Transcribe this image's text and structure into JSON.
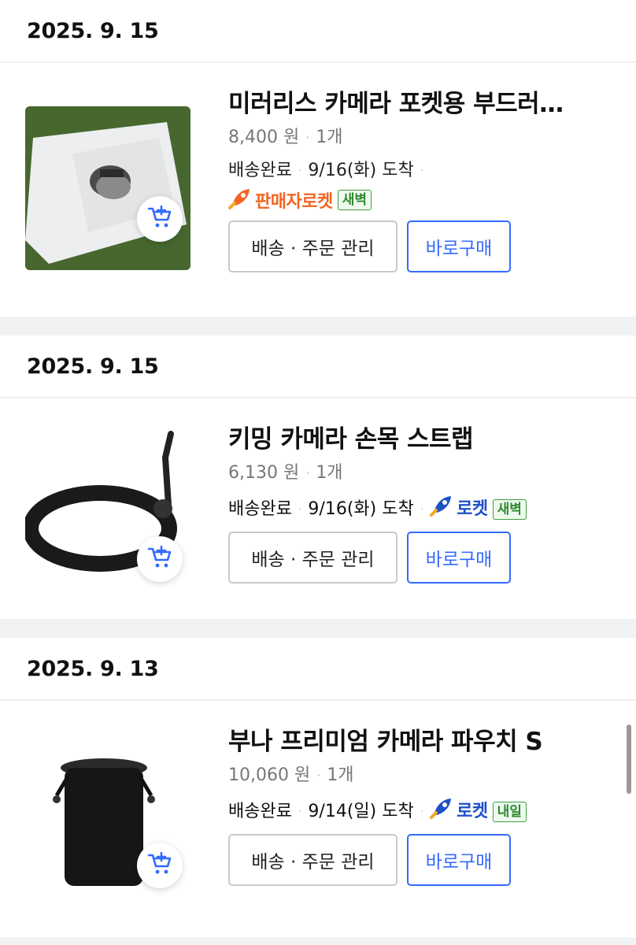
{
  "orders": [
    {
      "date": "2025. 9. 15",
      "title": "미러리스 카메라 포켓용 부드러…",
      "price": "8,400 원",
      "qty": "1개",
      "status": "배송완료",
      "arrival": "9/16(화) 도착",
      "badge_text": "판매자로켓",
      "badge_color": "#f26522",
      "tag": "새벽",
      "manage_label": "배송 · 주문 관리",
      "buy_label": "바로구매"
    },
    {
      "date": "2025. 9. 15",
      "title": "키밍 카메라 손목 스트랩",
      "price": "6,130 원",
      "qty": "1개",
      "status": "배송완료",
      "arrival": "9/16(화) 도착",
      "badge_text": "로켓",
      "badge_color": "#1e50c8",
      "tag": "새벽",
      "manage_label": "배송 · 주문 관리",
      "buy_label": "바로구매"
    },
    {
      "date": "2025. 9. 13",
      "title": "부나 프리미엄 카메라 파우치 S",
      "price": "10,060 원",
      "qty": "1개",
      "status": "배송완료",
      "arrival": "9/14(일) 도착",
      "badge_text": "로켓",
      "badge_color": "#1e50c8",
      "tag": "내일",
      "manage_label": "배송 · 주문 관리",
      "buy_label": "바로구매"
    }
  ],
  "icons": {
    "cart": "add-to-cart-icon",
    "rocket": "rocket-icon"
  },
  "colors": {
    "accent": "#346aff",
    "tag_green": "#2f8a2f"
  }
}
